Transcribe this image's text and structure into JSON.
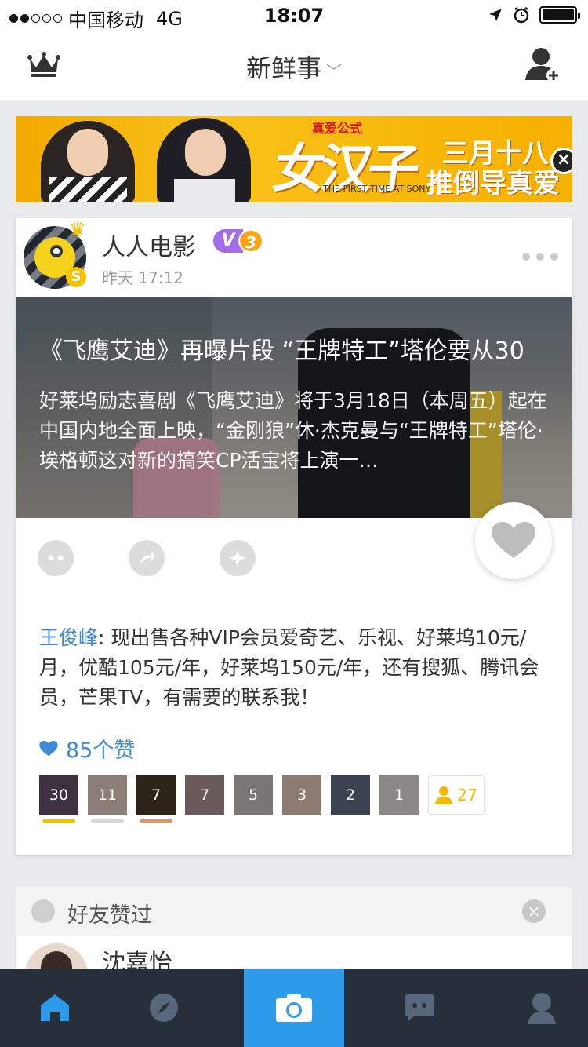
{
  "status_bar": {
    "carrier": "中国移动",
    "network": "4G",
    "time": "18:07",
    "signal_bars_filled": 2,
    "signal_bars_total": 5,
    "battery_level": 1.0
  },
  "nav": {
    "title": "新鲜事",
    "left_icon": "crown-icon",
    "right_icon": "add-friend-icon"
  },
  "banner": {
    "small_tag": "真爱公式",
    "title": "女汉子",
    "subtitle_en": "THE FIRST TIME AT SONY",
    "tag_line1": "三月十八",
    "tag_line2": "推倒导真爱"
  },
  "post": {
    "author": "人人电影",
    "vip_badge": "V",
    "vip_level": "3",
    "time": "昨天 17:12",
    "article": {
      "headline": "《飞鹰艾迪》再曝片段 “王牌特工”塔伦要从30",
      "summary": "好莱坞励志喜剧《飞鹰艾迪》将于3月18日（本周五）起在中国内地全面上映，“金刚狼”休·杰克曼与“王牌特工”塔伦·埃格顿这对新的搞笑CP活宝将上演一…"
    },
    "comment": {
      "author": "王俊峰",
      "separator": ": ",
      "text": "现出售各种VIP会员爱奇艺、乐视、好莱坞10元/月，优酷105元/年，好莱坞150元/年，还有搜狐、腾讯会员，芒果TV，有需要的联系我！"
    },
    "likes_text": "85个赞",
    "likers": [
      {
        "count": "30",
        "bg": "#3d3140",
        "bar": "#f3c200"
      },
      {
        "count": "11",
        "bg": "#8a7e76",
        "bar": "#d6d6d6"
      },
      {
        "count": "7",
        "bg": "#2d2418",
        "bar": "#d89a6a"
      },
      {
        "count": "7",
        "bg": "#6a5a5a",
        "bar": ""
      },
      {
        "count": "5",
        "bg": "#7a7674",
        "bar": ""
      },
      {
        "count": "3",
        "bg": "#8b7b70",
        "bar": ""
      },
      {
        "count": "2",
        "bg": "#3c4350",
        "bar": ""
      },
      {
        "count": "1",
        "bg": "#8c8888",
        "bar": ""
      }
    ],
    "likers_more": "27"
  },
  "friend_section": {
    "title": "好友赞过",
    "friend_name": "沈嘉怡"
  },
  "tab_bar": {
    "tabs": [
      "home-icon",
      "discover-icon",
      "camera-icon",
      "chat-icon",
      "profile-icon"
    ],
    "active_color": "#2e9bea",
    "home_color": "#2e9bea",
    "inactive_color": "#58677c"
  }
}
